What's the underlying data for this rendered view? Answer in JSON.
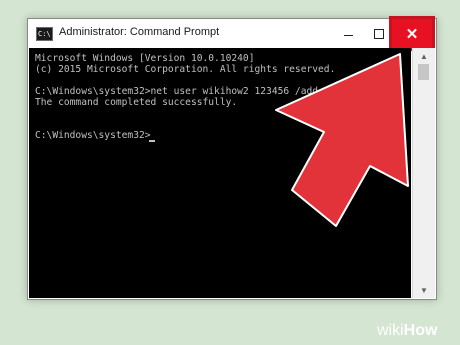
{
  "window": {
    "title": "Administrator: Command Prompt",
    "icon_text": "C:\\",
    "controls": {
      "minimize_icon": "minimize-icon",
      "maximize_icon": "maximize-icon",
      "close_icon": "close-icon",
      "close_glyph": "✕"
    }
  },
  "console": {
    "lines": [
      "Microsoft Windows [Version 10.0.10240]",
      "(c) 2015 Microsoft Corporation. All rights reserved.",
      "",
      "C:\\Windows\\system32>net user wikihow2 123456 /add",
      "The command completed successfully.",
      "",
      "",
      "C:\\Windows\\system32>"
    ]
  },
  "scrollbar": {
    "up_glyph": "▲",
    "down_glyph": "▼"
  },
  "annotation": {
    "arrow_color": "#e2323a"
  },
  "watermark": {
    "wiki": "wiki",
    "how": "How"
  },
  "colors": {
    "close_button": "#e81123",
    "console_bg": "#000000",
    "console_text": "#c0c0c0",
    "page_bg": "#d4e6d1"
  }
}
